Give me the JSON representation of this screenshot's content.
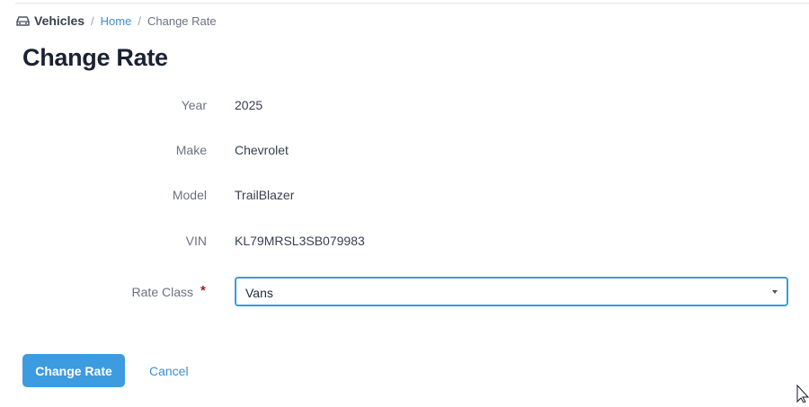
{
  "breadcrumb": {
    "section_icon": "car-icon",
    "section": "Vehicles",
    "separator": "/",
    "home": "Home",
    "current": "Change Rate"
  },
  "page_title": "Change Rate",
  "fields": {
    "year": {
      "label": "Year",
      "value": "2025"
    },
    "make": {
      "label": "Make",
      "value": "Chevrolet"
    },
    "model": {
      "label": "Model",
      "value": "TrailBlazer"
    },
    "vin": {
      "label": "VIN",
      "value": "KL79MRSL3SB079983"
    }
  },
  "rate_class": {
    "label": "Rate Class",
    "required_marker": "*",
    "selected": "Vans"
  },
  "actions": {
    "submit_label": "Change Rate",
    "cancel_label": "Cancel"
  },
  "colors": {
    "accent": "#3d9be0",
    "link": "#3b8fd6",
    "required": "#9b1c1c"
  }
}
